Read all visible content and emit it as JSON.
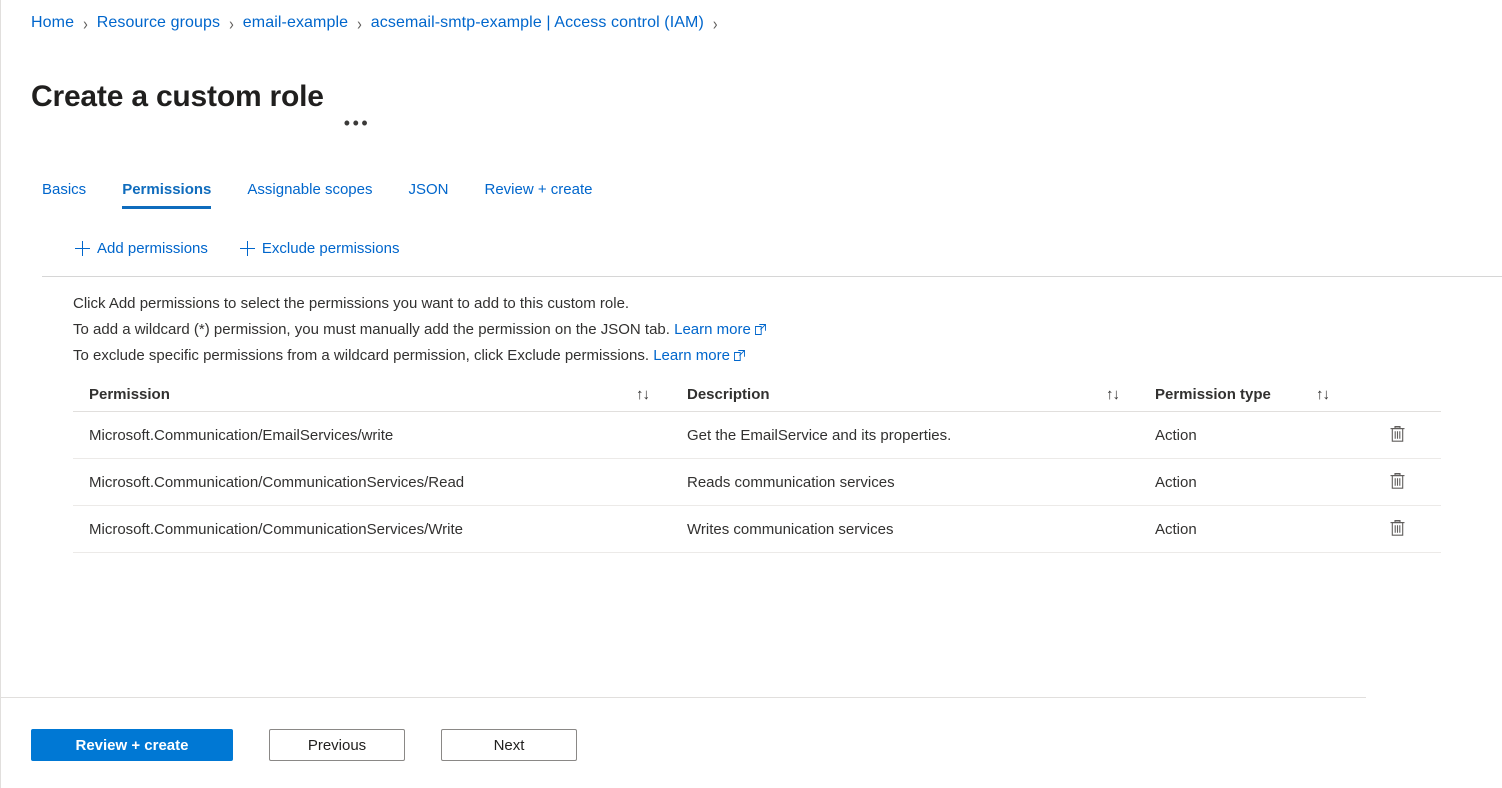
{
  "breadcrumb": {
    "separator": "›",
    "items": [
      "Home",
      "Resource groups",
      "email-example",
      "acsemail-smtp-example | Access control (IAM)"
    ]
  },
  "header": {
    "title": "Create a custom role",
    "more_label": "•••"
  },
  "tabs": [
    {
      "label": "Basics",
      "active": false
    },
    {
      "label": "Permissions",
      "active": true
    },
    {
      "label": "Assignable scopes",
      "active": false
    },
    {
      "label": "JSON",
      "active": false
    },
    {
      "label": "Review + create",
      "active": false
    }
  ],
  "commandbar": [
    {
      "label": "Add permissions",
      "icon": "plus-icon"
    },
    {
      "label": "Exclude permissions",
      "icon": "plus-icon"
    }
  ],
  "instructions": {
    "line1": "Click Add permissions to select the permissions you want to add to this custom role.",
    "line2_text": "To add a wildcard (*) permission, you must manually add the permission on the JSON tab.",
    "line2_link": "Learn more",
    "line3_text": "To exclude specific permissions from a wildcard permission, click Exclude permissions.",
    "line3_link": "Learn more"
  },
  "table": {
    "columns": [
      {
        "label": "Permission",
        "sort": "↑↓"
      },
      {
        "label": "Description",
        "sort": "↑↓"
      },
      {
        "label": "Permission type",
        "sort": "↑↓"
      }
    ],
    "rows": [
      {
        "permission": "Microsoft.Communication/EmailServices/write",
        "description": "Get the EmailService and its properties.",
        "type": "Action",
        "action_icon": "trash-icon"
      },
      {
        "permission": "Microsoft.Communication/CommunicationServices/Read",
        "description": "Reads communication services",
        "type": "Action",
        "action_icon": "trash-icon"
      },
      {
        "permission": "Microsoft.Communication/CommunicationServices/Write",
        "description": "Writes communication services",
        "type": "Action",
        "action_icon": "trash-icon"
      }
    ]
  },
  "footer": {
    "review_create": "Review + create",
    "previous": "Previous",
    "next": "Next"
  },
  "colors": {
    "accent": "#0078d4",
    "link": "#0066cc",
    "tab_active": "#0f6cbd",
    "text": "#323130"
  }
}
